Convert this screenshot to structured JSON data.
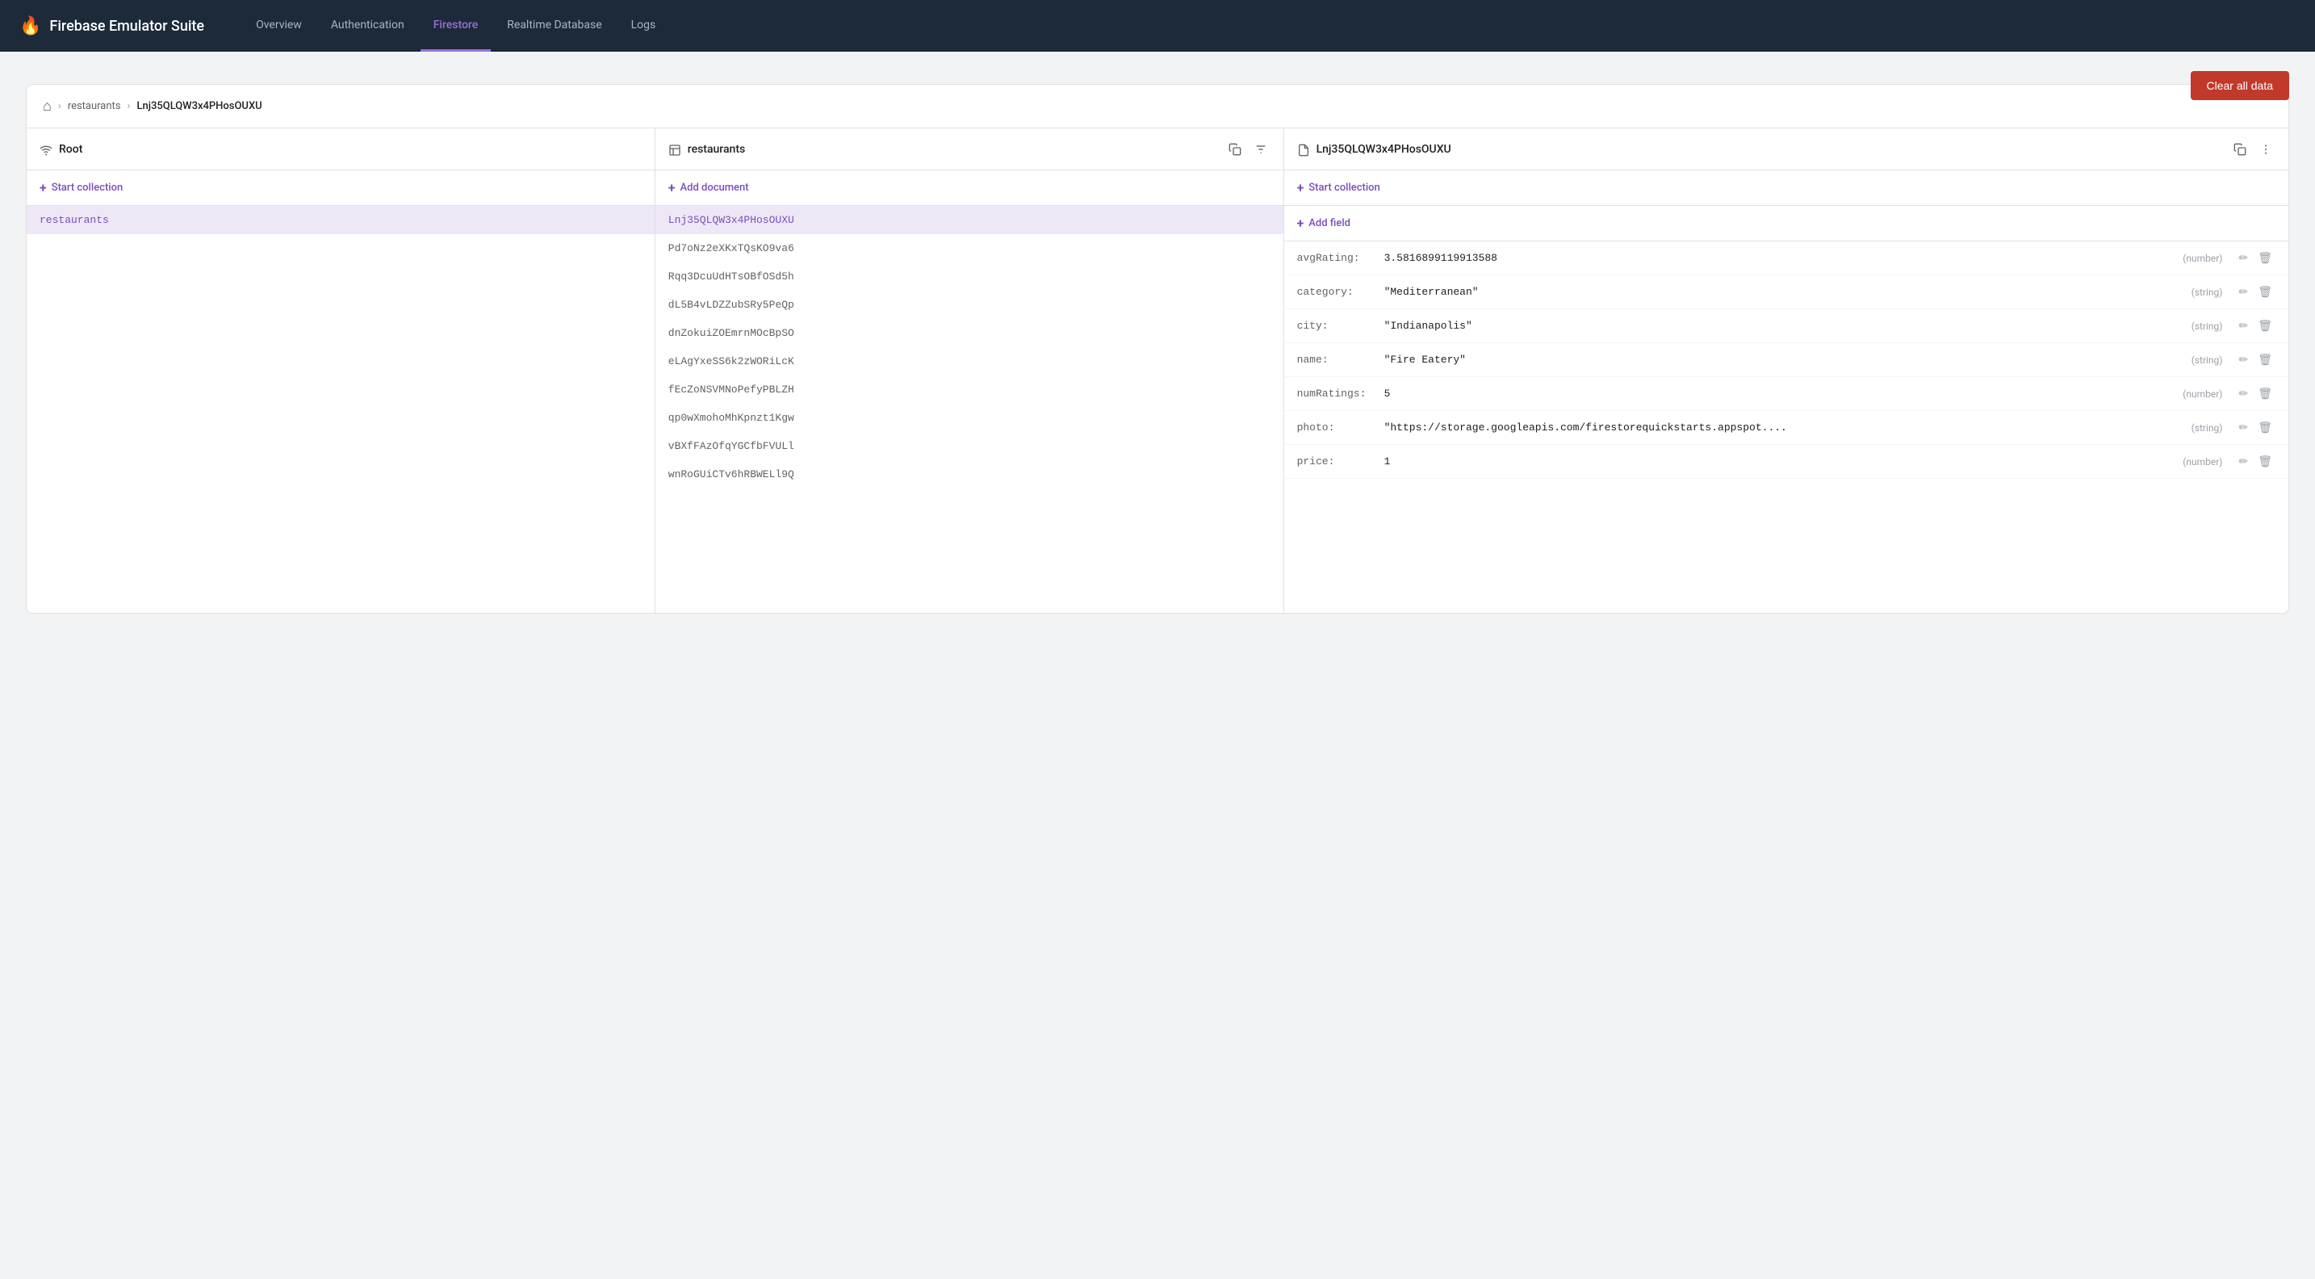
{
  "app": {
    "title": "Firebase Emulator Suite",
    "fire_icon": "🔥"
  },
  "nav": {
    "links": [
      {
        "id": "overview",
        "label": "Overview",
        "active": false
      },
      {
        "id": "authentication",
        "label": "Authentication",
        "active": false
      },
      {
        "id": "firestore",
        "label": "Firestore",
        "active": true
      },
      {
        "id": "realtime-database",
        "label": "Realtime Database",
        "active": false
      },
      {
        "id": "logs",
        "label": "Logs",
        "active": false
      }
    ]
  },
  "toolbar": {
    "clear_all_data": "Clear all data"
  },
  "breadcrumb": {
    "home_icon": "⌂",
    "segments": [
      {
        "label": "restaurants",
        "type": "link"
      },
      {
        "label": "Lnj35QLQW3x4PHosOUXU",
        "type": "current"
      }
    ]
  },
  "columns": {
    "root": {
      "title": "Root",
      "add_collection_label": "Start collection",
      "items": [
        {
          "label": "restaurants",
          "selected": true
        }
      ]
    },
    "restaurants": {
      "title": "restaurants",
      "add_document_label": "Add document",
      "items": [
        {
          "label": "Lnj35QLQW3x4PHosOUXU",
          "selected": true
        },
        {
          "label": "Pd7oNz2eXKxTQsKO9va6",
          "selected": false
        },
        {
          "label": "Rqq3DcuUdHTsOBfOSd5h",
          "selected": false
        },
        {
          "label": "dL5B4vLDZZubSRy5PeQp",
          "selected": false
        },
        {
          "label": "dnZokuiZOEmrnMOcBpSO",
          "selected": false
        },
        {
          "label": "eLAgYxeSS6k2zWORiLcK",
          "selected": false
        },
        {
          "label": "fEcZoNSVMNoPefyPBLZH",
          "selected": false
        },
        {
          "label": "qp0wXmohoMhKpnzt1Kgw",
          "selected": false
        },
        {
          "label": "vBXfFAzOfqYGCfbFVULl",
          "selected": false
        },
        {
          "label": "wnRoGUiCTv6hRBWELl9Q",
          "selected": false
        }
      ]
    },
    "document": {
      "title": "Lnj35QLQW3x4PHosOUXU",
      "add_collection_label": "Start collection",
      "add_field_label": "Add field",
      "fields": [
        {
          "key": "avgRating:",
          "value": "3.5816899119913588",
          "type": "(number)"
        },
        {
          "key": "category:",
          "value": "\"Mediterranean\"",
          "type": "(string)"
        },
        {
          "key": "city:",
          "value": "\"Indianapolis\"",
          "type": "(string)"
        },
        {
          "key": "name:",
          "value": "\"Fire Eatery\"",
          "type": "(string)"
        },
        {
          "key": "numRatings:",
          "value": "5",
          "type": "(number)"
        },
        {
          "key": "photo:",
          "value": "\"https://storage.googleapis.com/firestorequickstarts.appspot....",
          "type": "(string)"
        },
        {
          "key": "price:",
          "value": "1",
          "type": "(number)"
        }
      ]
    }
  },
  "icons": {
    "root_icon": "wifi",
    "doc_icon": "📄",
    "col_icon": "📁",
    "copy": "⧉",
    "filter": "≡",
    "more": "⋮",
    "edit": "✏",
    "delete": "🗑"
  }
}
